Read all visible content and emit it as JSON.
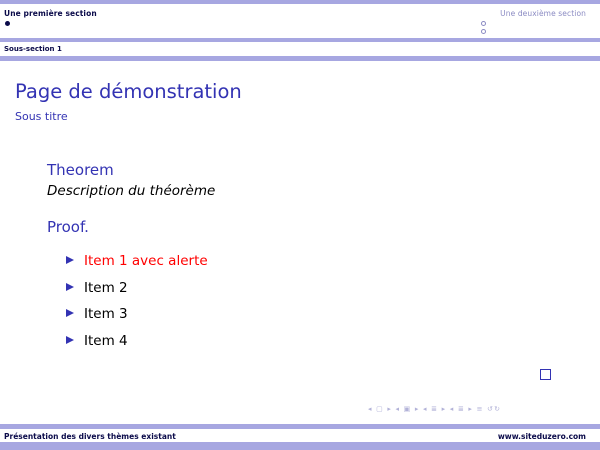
{
  "colors": {
    "bar": "#a7a7e1",
    "structure": "#3333b3",
    "dark_text": "#0b0b4a",
    "alert": "#ff0000",
    "nav": "#b2b2d8"
  },
  "headline": {
    "section_1": "Une première section",
    "section_2": "Une deuxième section",
    "section_1_bullets": [
      "filled"
    ],
    "section_2_bullets": [
      "hollow",
      "hollow"
    ]
  },
  "subsection": "Sous-section 1",
  "frame": {
    "title": "Page de démonstration",
    "subtitle": "Sous titre",
    "theorem_title": "Theorem",
    "theorem_body": "Description du théorème",
    "proof_title": "Proof.",
    "items": [
      {
        "label": "Item 1 avec alerte",
        "alert": true
      },
      {
        "label": "Item 2",
        "alert": false
      },
      {
        "label": "Item 3",
        "alert": false
      },
      {
        "label": "Item 4",
        "alert": false
      }
    ],
    "qed_icon": "qed-square-icon"
  },
  "nav_symbols": "◂ ▢ ▸ ◂ ▣ ▸ ◂ ≣ ▸ ◂ ≣ ▸  ≡  ↺↻",
  "footer": {
    "left": "Présentation des divers thèmes existant",
    "right": "www.siteduzero.com"
  }
}
